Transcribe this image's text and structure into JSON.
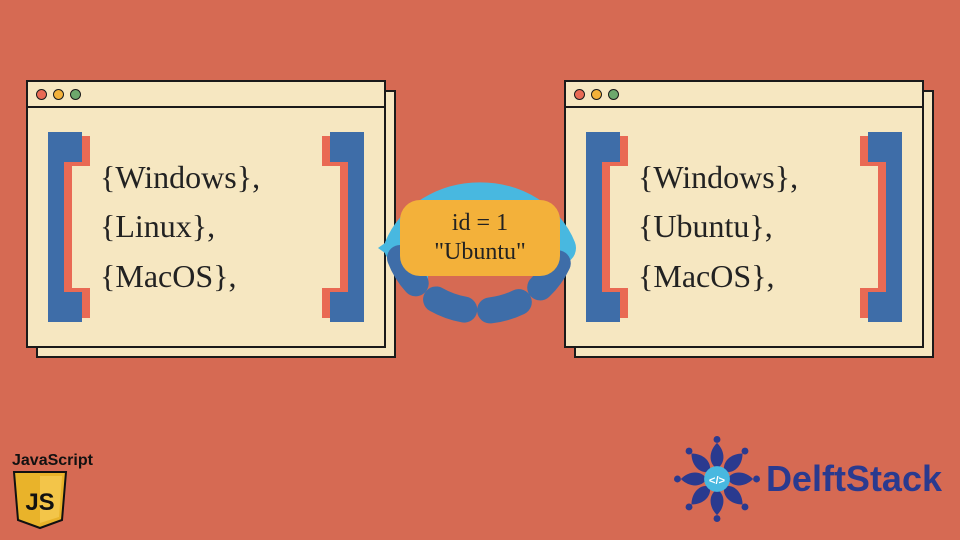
{
  "colors": {
    "bg": "#d66a53",
    "card": "#f6e7c1",
    "border": "#1a1a1a",
    "bracketFace": "#3e6da8",
    "bracketSide": "#e96a54",
    "arrowSolid": "#48b8e0",
    "arrowDash": "#3e6da8",
    "pill": "#f3b13a",
    "brand": "#2a3a8f"
  },
  "left_window": {
    "items": [
      "{Windows},",
      "{Linux},",
      "{MacOS},"
    ]
  },
  "right_window": {
    "items": [
      "{Windows},",
      "{Ubuntu},",
      "{MacOS},"
    ]
  },
  "swap": {
    "line1": "id = 1",
    "line2": "\"Ubuntu\""
  },
  "js_badge": {
    "label": "JavaScript",
    "glyph": "JS"
  },
  "brand": {
    "name": "DelftStack",
    "tag_glyph": "</>"
  }
}
